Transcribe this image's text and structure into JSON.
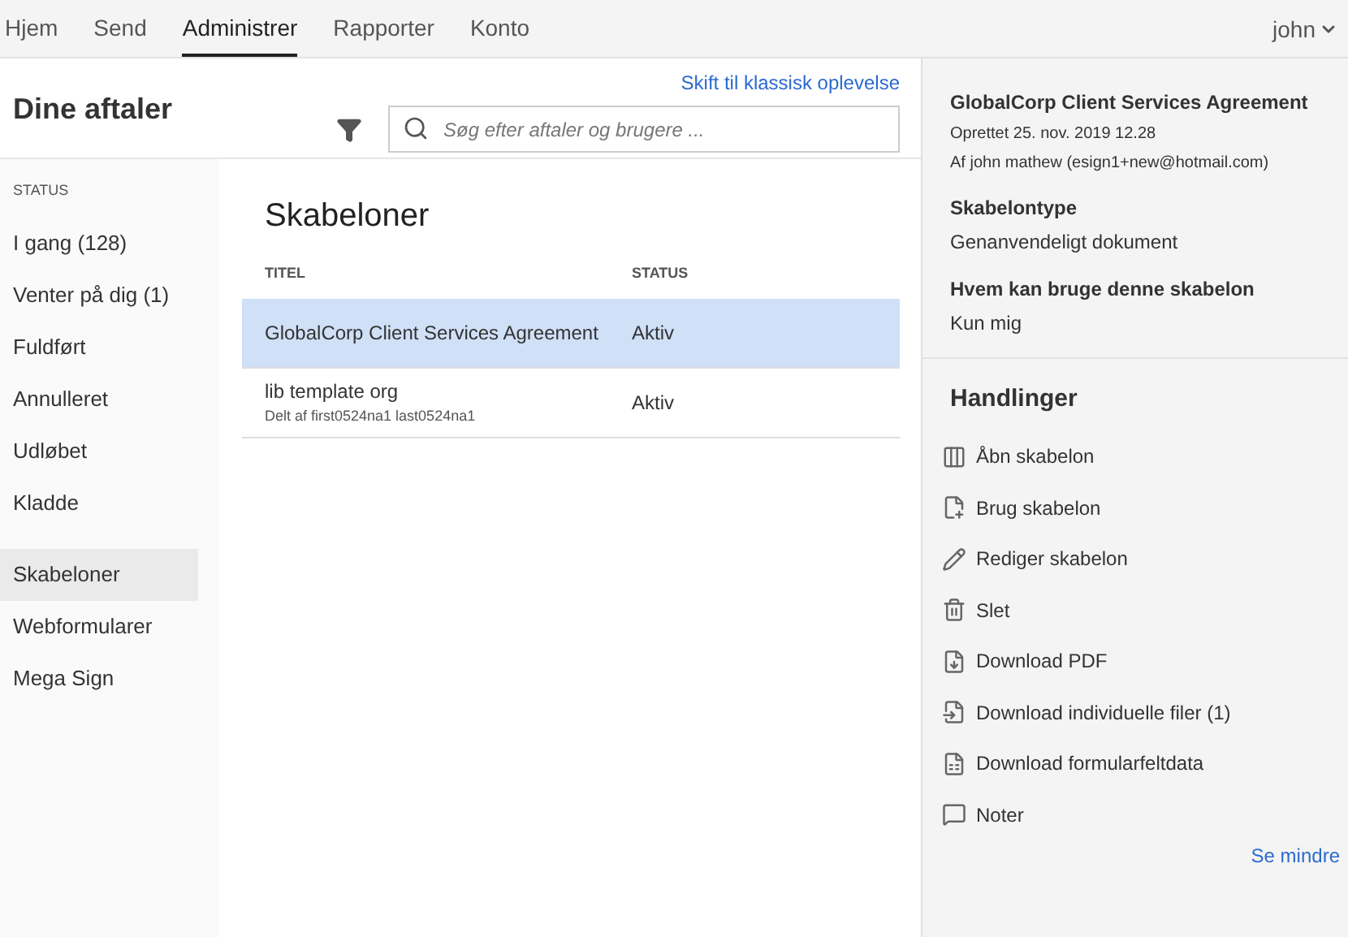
{
  "nav": {
    "tabs": [
      {
        "label": "Hjem",
        "selected": false
      },
      {
        "label": "Send",
        "selected": false
      },
      {
        "label": "Administrer",
        "selected": true
      },
      {
        "label": "Rapporter",
        "selected": false
      },
      {
        "label": "Konto",
        "selected": false
      }
    ],
    "user": "john"
  },
  "header": {
    "title": "Dine aftaler",
    "classic_link": "Skift til klassisk oplevelse",
    "search": {
      "placeholder": "Søg efter aftaler og brugere ..."
    }
  },
  "sidebar": {
    "heading": "STATUS",
    "items": [
      {
        "label": "I gang (128)",
        "selected": false
      },
      {
        "label": "Venter på dig (1)",
        "selected": false
      },
      {
        "label": "Fuldført",
        "selected": false
      },
      {
        "label": "Annulleret",
        "selected": false
      },
      {
        "label": "Udløbet",
        "selected": false
      },
      {
        "label": "Kladde",
        "selected": false
      }
    ],
    "items2": [
      {
        "label": "Skabeloner",
        "selected": true
      },
      {
        "label": "Webformularer",
        "selected": false
      },
      {
        "label": "Mega Sign",
        "selected": false
      }
    ]
  },
  "main": {
    "title": "Skabeloner",
    "table": {
      "columns": [
        "TITEL",
        "STATUS"
      ],
      "rows": [
        {
          "title": "GlobalCorp Client Services Agreement",
          "status": "Aktiv",
          "selected": true
        },
        {
          "title": "lib template org",
          "subtitle": "Delt af first0524na1 last0524na1",
          "status": "Aktiv",
          "selected": false
        }
      ]
    }
  },
  "details": {
    "title": "GlobalCorp Client Services Agreement",
    "created": "Oprettet 25. nov. 2019 12.28",
    "author": "Af john mathew (esign1+new@hotmail.com)",
    "fields": [
      {
        "label": "Skabelontype",
        "value": "Genanvendeligt dokument"
      },
      {
        "label": "Hvem kan bruge denne skabelon",
        "value": "Kun mig"
      }
    ],
    "actions_title": "Handlinger",
    "actions": [
      {
        "kind": "open",
        "label": "Åbn skabelon"
      },
      {
        "kind": "use",
        "label": "Brug skabelon"
      },
      {
        "kind": "edit",
        "label": "Rediger skabelon"
      },
      {
        "kind": "delete",
        "label": "Slet"
      },
      {
        "kind": "pdf",
        "label": "Download PDF"
      },
      {
        "kind": "files",
        "label": "Download individuelle filer (1)"
      },
      {
        "kind": "formdata",
        "label": "Download formularfeltdata"
      },
      {
        "kind": "notes",
        "label": "Noter"
      }
    ],
    "less_link": "Se mindre"
  }
}
